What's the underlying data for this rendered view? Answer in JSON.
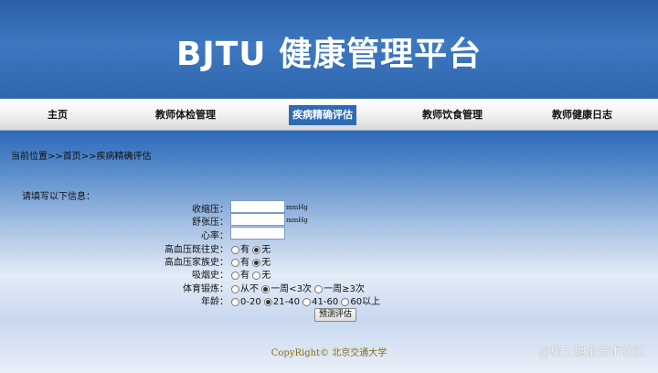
{
  "header": {
    "title": "BJTU 健康管理平台"
  },
  "nav": {
    "items": [
      {
        "label": "主页"
      },
      {
        "label": "教师体检管理"
      },
      {
        "label": "疾病精确评估"
      },
      {
        "label": "教师饮食管理"
      },
      {
        "label": "教师健康日志"
      }
    ]
  },
  "breadcrumb": "当前位置>>首页>>疾病精确评估",
  "form": {
    "intro": "请填写以下信息：",
    "systolic": {
      "label": "收缩压：",
      "value": "",
      "unit": "mmHg"
    },
    "diastolic": {
      "label": "舒张压：",
      "value": "",
      "unit": "mmHg"
    },
    "heart_rate": {
      "label": "心率：",
      "value": ""
    },
    "hypertension_history": {
      "label": "高血压既往史：",
      "options": [
        "有",
        "无"
      ],
      "selected": "无"
    },
    "family_history": {
      "label": "高血压家族史：",
      "options": [
        "有",
        "无"
      ],
      "selected": "无"
    },
    "smoking": {
      "label": "吸烟史：",
      "options": [
        "有",
        "无"
      ],
      "selected": ""
    },
    "exercise": {
      "label": "体育锻炼：",
      "options": [
        "从不",
        "一周<3次",
        "一周≥3次"
      ],
      "selected": "一周<3次"
    },
    "age": {
      "label": "年龄：",
      "options": [
        "0-20",
        "21-40",
        "41-60",
        "60以上"
      ],
      "selected": "21-40"
    },
    "submit_label": "预测评估"
  },
  "footer": "CopyRight© 北京交通大学",
  "watermark": "@稀土掘金技术社区"
}
